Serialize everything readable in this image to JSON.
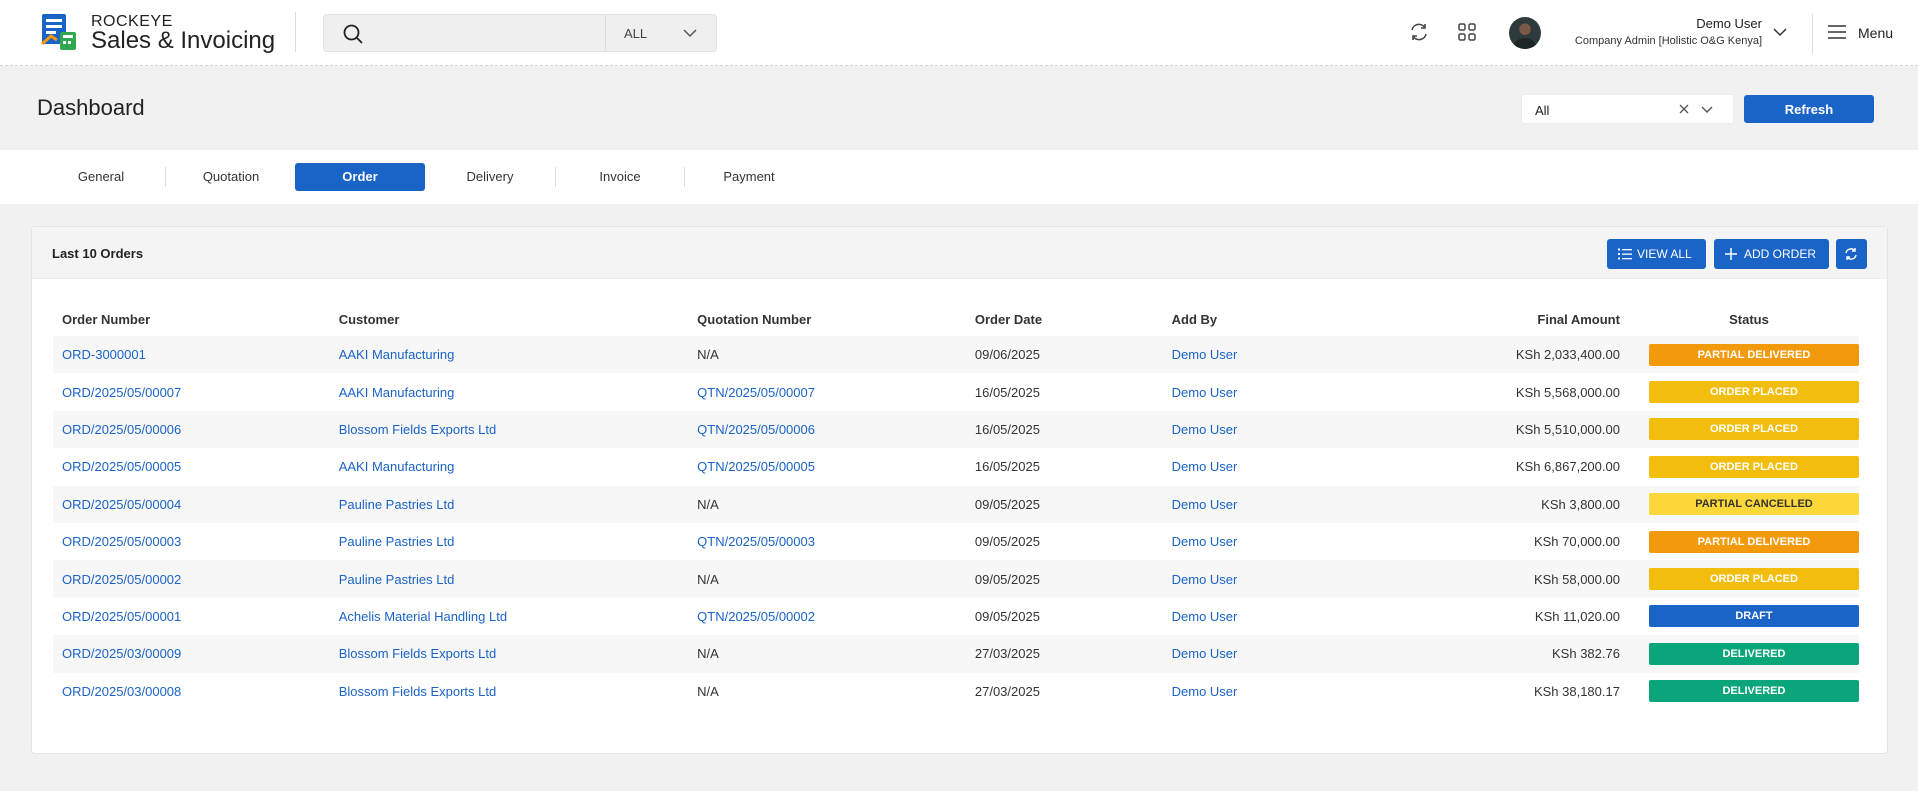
{
  "app": {
    "brand_top": "ROCKEYE",
    "brand_main": "Sales & Invoicing"
  },
  "search": {
    "placeholder": "",
    "value": "",
    "scope": "ALL"
  },
  "user": {
    "name": "Demo User",
    "role": "Company Admin [Holistic O&G Kenya]"
  },
  "menu_label": "Menu",
  "page": {
    "title": "Dashboard",
    "filter_value": "All",
    "refresh_label": "Refresh"
  },
  "tabs": [
    {
      "label": "General"
    },
    {
      "label": "Quotation"
    },
    {
      "label": "Order"
    },
    {
      "label": "Delivery"
    },
    {
      "label": "Invoice"
    },
    {
      "label": "Payment"
    }
  ],
  "active_tab": "Order",
  "card": {
    "title": "Last 10 Orders",
    "view_all_label": "VIEW ALL",
    "add_order_label": "ADD ORDER"
  },
  "table": {
    "columns": [
      "Order Number",
      "Customer",
      "Quotation Number",
      "Order Date",
      "Add By",
      "Final Amount",
      "Status"
    ],
    "rows": [
      {
        "order": "ORD-3000001",
        "customer": "AAKI Manufacturing",
        "quotation": "N/A",
        "date": "09/06/2025",
        "by": "Demo User",
        "amount": "KSh 2,033,400.00",
        "status": "PARTIAL DELIVERED",
        "status_color": "#f39a0c",
        "status_text_color": "#ffffff"
      },
      {
        "order": "ORD/2025/05/00007",
        "customer": "AAKI Manufacturing",
        "quotation": "QTN/2025/05/00007",
        "date": "16/05/2025",
        "by": "Demo User",
        "amount": "KSh 5,568,000.00",
        "status": "ORDER PLACED",
        "status_color": "#f2bd0c",
        "status_text_color": "#ffffff"
      },
      {
        "order": "ORD/2025/05/00006",
        "customer": "Blossom Fields Exports Ltd",
        "quotation": "QTN/2025/05/00006",
        "date": "16/05/2025",
        "by": "Demo User",
        "amount": "KSh 5,510,000.00",
        "status": "ORDER PLACED",
        "status_color": "#f2bd0c",
        "status_text_color": "#ffffff"
      },
      {
        "order": "ORD/2025/05/00005",
        "customer": "AAKI Manufacturing",
        "quotation": "QTN/2025/05/00005",
        "date": "16/05/2025",
        "by": "Demo User",
        "amount": "KSh 6,867,200.00",
        "status": "ORDER PLACED",
        "status_color": "#f2bd0c",
        "status_text_color": "#ffffff"
      },
      {
        "order": "ORD/2025/05/00004",
        "customer": "Pauline Pastries Ltd",
        "quotation": "N/A",
        "date": "09/05/2025",
        "by": "Demo User",
        "amount": "KSh 3,800.00",
        "status": "PARTIAL CANCELLED",
        "status_color": "#fcd73a",
        "status_text_color": "#333333"
      },
      {
        "order": "ORD/2025/05/00003",
        "customer": "Pauline Pastries Ltd",
        "quotation": "QTN/2025/05/00003",
        "date": "09/05/2025",
        "by": "Demo User",
        "amount": "KSh 70,000.00",
        "status": "PARTIAL DELIVERED",
        "status_color": "#f39a0c",
        "status_text_color": "#ffffff"
      },
      {
        "order": "ORD/2025/05/00002",
        "customer": "Pauline Pastries Ltd",
        "quotation": "N/A",
        "date": "09/05/2025",
        "by": "Demo User",
        "amount": "KSh 58,000.00",
        "status": "ORDER PLACED",
        "status_color": "#f2bd0c",
        "status_text_color": "#ffffff"
      },
      {
        "order": "ORD/2025/05/00001",
        "customer": "Achelis Material Handling Ltd",
        "quotation": "QTN/2025/05/00002",
        "date": "09/05/2025",
        "by": "Demo User",
        "amount": "KSh 11,020.00",
        "status": "DRAFT",
        "status_color": "#1a63c7",
        "status_text_color": "#ffffff"
      },
      {
        "order": "ORD/2025/03/00009",
        "customer": "Blossom Fields Exports Ltd",
        "quotation": "N/A",
        "date": "27/03/2025",
        "by": "Demo User",
        "amount": "KSh 382.76",
        "status": "DELIVERED",
        "status_color": "#0aa57a",
        "status_text_color": "#ffffff"
      },
      {
        "order": "ORD/2025/03/00008",
        "customer": "Blossom Fields Exports Ltd",
        "quotation": "N/A",
        "date": "27/03/2025",
        "by": "Demo User",
        "amount": "KSh 38,180.17",
        "status": "DELIVERED",
        "status_color": "#0aa57a",
        "status_text_color": "#ffffff"
      }
    ]
  },
  "colors": {
    "accent": "#1a63c7",
    "link": "#1a63c7"
  },
  "icons": [
    "app-logo-icon",
    "search-icon",
    "chevron-down-icon",
    "sync-icon",
    "apps-grid-icon",
    "hamburger-icon",
    "close-icon",
    "list-icon",
    "plus-icon",
    "refresh-icon"
  ]
}
